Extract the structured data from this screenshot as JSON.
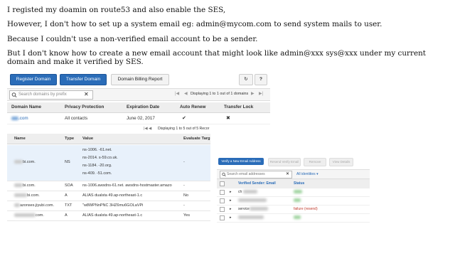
{
  "paragraphs": [
    "I registed my doamin on route53 and also enable the SES,",
    "However, I don't how to set up a system email eg: admin@mycom.com to send system mails to user.",
    "Because I couldn't use a non-verified email account to be a sender.",
    "But I don't know how to create a new email account that might look like admin@xxx sys@xxx under my current domain and make it verified by SES."
  ],
  "domains_panel": {
    "buttons": {
      "register": "Register Domain",
      "transfer": "Transfer Domain",
      "billing": "Domain Billing Report"
    },
    "refresh_icon": "↻",
    "help_icon": "?",
    "search_placeholder": "Search domains by prefix",
    "clear_icon": "✕",
    "pagination": {
      "first": "|◀",
      "prev": "◀",
      "text": "Displaying 1 to 1 out of 1 domains",
      "next": "▶",
      "last": "▶|"
    },
    "columns": [
      "Domain Name",
      "Privacy Protection",
      "Expiration Date",
      "Auto Renew",
      "Transfer Lock"
    ],
    "row": {
      "domain": ".com",
      "privacy": "All contacts",
      "expiration": "June 02, 2017",
      "auto_renew": "✔",
      "transfer_lock": "✖"
    }
  },
  "records_panel": {
    "pagination_text": "Displaying 1 to 5 out of 5 Recor",
    "columns": [
      "Name",
      "Type",
      "Value",
      "Evaluate Targ"
    ],
    "rows": [
      {
        "name": "bi.com.",
        "type": "NS",
        "values": [
          "ns-1006.     -61.net.",
          "ns-2014.     s-59.co.uk.",
          "ns-1184.     -20.org.",
          "ns-409.     -51.com."
        ],
        "evaluate": "-"
      },
      {
        "name": "bi.com.",
        "type": "SOA",
        "values": [
          "ns-1006.awsdns-61.net. awsdns-hostmaster.amazo"
        ],
        "evaluate": "-"
      },
      {
        "name": "bi.com.",
        "type": "A",
        "values": [
          "ALIAS dualsta     49.ap-northeast-1.c"
        ],
        "evaluate": "No"
      },
      {
        "name": "azonses.jiyubi.com.",
        "type": "TXT",
        "values": [
          "\"w8WPNnPNC     3HZ6mu6GOLaVPi"
        ],
        "evaluate": "-"
      },
      {
        "name": "com.",
        "type": "A",
        "values": [
          "ALIAS dualsta     49.ap-northeast-1.c"
        ],
        "evaluate": "Yes"
      }
    ]
  },
  "ses_panel": {
    "buttons": {
      "verify": "Verify a New Email Address",
      "resend": "Resend Verify Email",
      "remove": "Remove",
      "view": "View Details"
    },
    "search_placeholder": "Search email addresses",
    "clear_icon": "✕",
    "filter": "All identities",
    "columns": [
      "Verified Sender: Email",
      "Status"
    ],
    "rows": [
      {
        "email": "ch",
        "status": ""
      },
      {
        "email": "",
        "status": ""
      },
      {
        "email": "service",
        "status": "failure (resend)"
      },
      {
        "email": "",
        "status": ""
      }
    ]
  }
}
